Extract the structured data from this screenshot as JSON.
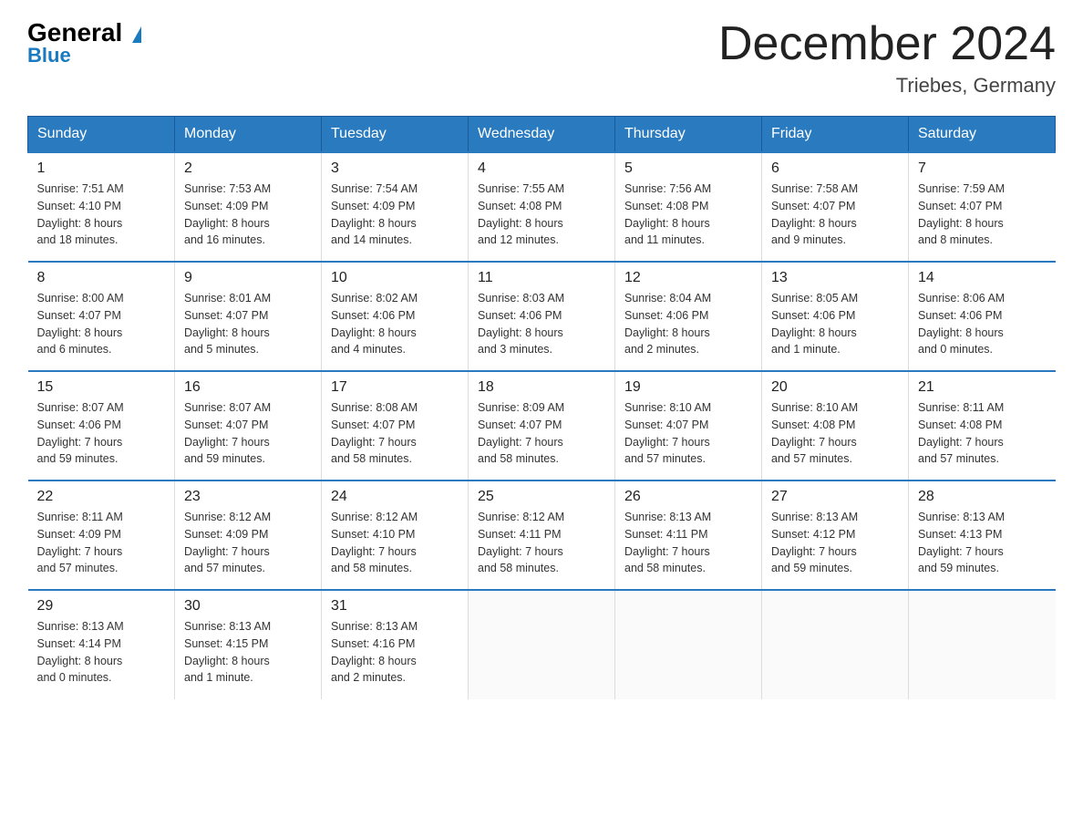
{
  "logo": {
    "general": "General",
    "blue": "Blue",
    "triangle": "▲"
  },
  "title": "December 2024",
  "subtitle": "Triebes, Germany",
  "days_of_week": [
    "Sunday",
    "Monday",
    "Tuesday",
    "Wednesday",
    "Thursday",
    "Friday",
    "Saturday"
  ],
  "weeks": [
    [
      {
        "num": "1",
        "info": "Sunrise: 7:51 AM\nSunset: 4:10 PM\nDaylight: 8 hours\nand 18 minutes."
      },
      {
        "num": "2",
        "info": "Sunrise: 7:53 AM\nSunset: 4:09 PM\nDaylight: 8 hours\nand 16 minutes."
      },
      {
        "num": "3",
        "info": "Sunrise: 7:54 AM\nSunset: 4:09 PM\nDaylight: 8 hours\nand 14 minutes."
      },
      {
        "num": "4",
        "info": "Sunrise: 7:55 AM\nSunset: 4:08 PM\nDaylight: 8 hours\nand 12 minutes."
      },
      {
        "num": "5",
        "info": "Sunrise: 7:56 AM\nSunset: 4:08 PM\nDaylight: 8 hours\nand 11 minutes."
      },
      {
        "num": "6",
        "info": "Sunrise: 7:58 AM\nSunset: 4:07 PM\nDaylight: 8 hours\nand 9 minutes."
      },
      {
        "num": "7",
        "info": "Sunrise: 7:59 AM\nSunset: 4:07 PM\nDaylight: 8 hours\nand 8 minutes."
      }
    ],
    [
      {
        "num": "8",
        "info": "Sunrise: 8:00 AM\nSunset: 4:07 PM\nDaylight: 8 hours\nand 6 minutes."
      },
      {
        "num": "9",
        "info": "Sunrise: 8:01 AM\nSunset: 4:07 PM\nDaylight: 8 hours\nand 5 minutes."
      },
      {
        "num": "10",
        "info": "Sunrise: 8:02 AM\nSunset: 4:06 PM\nDaylight: 8 hours\nand 4 minutes."
      },
      {
        "num": "11",
        "info": "Sunrise: 8:03 AM\nSunset: 4:06 PM\nDaylight: 8 hours\nand 3 minutes."
      },
      {
        "num": "12",
        "info": "Sunrise: 8:04 AM\nSunset: 4:06 PM\nDaylight: 8 hours\nand 2 minutes."
      },
      {
        "num": "13",
        "info": "Sunrise: 8:05 AM\nSunset: 4:06 PM\nDaylight: 8 hours\nand 1 minute."
      },
      {
        "num": "14",
        "info": "Sunrise: 8:06 AM\nSunset: 4:06 PM\nDaylight: 8 hours\nand 0 minutes."
      }
    ],
    [
      {
        "num": "15",
        "info": "Sunrise: 8:07 AM\nSunset: 4:06 PM\nDaylight: 7 hours\nand 59 minutes."
      },
      {
        "num": "16",
        "info": "Sunrise: 8:07 AM\nSunset: 4:07 PM\nDaylight: 7 hours\nand 59 minutes."
      },
      {
        "num": "17",
        "info": "Sunrise: 8:08 AM\nSunset: 4:07 PM\nDaylight: 7 hours\nand 58 minutes."
      },
      {
        "num": "18",
        "info": "Sunrise: 8:09 AM\nSunset: 4:07 PM\nDaylight: 7 hours\nand 58 minutes."
      },
      {
        "num": "19",
        "info": "Sunrise: 8:10 AM\nSunset: 4:07 PM\nDaylight: 7 hours\nand 57 minutes."
      },
      {
        "num": "20",
        "info": "Sunrise: 8:10 AM\nSunset: 4:08 PM\nDaylight: 7 hours\nand 57 minutes."
      },
      {
        "num": "21",
        "info": "Sunrise: 8:11 AM\nSunset: 4:08 PM\nDaylight: 7 hours\nand 57 minutes."
      }
    ],
    [
      {
        "num": "22",
        "info": "Sunrise: 8:11 AM\nSunset: 4:09 PM\nDaylight: 7 hours\nand 57 minutes."
      },
      {
        "num": "23",
        "info": "Sunrise: 8:12 AM\nSunset: 4:09 PM\nDaylight: 7 hours\nand 57 minutes."
      },
      {
        "num": "24",
        "info": "Sunrise: 8:12 AM\nSunset: 4:10 PM\nDaylight: 7 hours\nand 58 minutes."
      },
      {
        "num": "25",
        "info": "Sunrise: 8:12 AM\nSunset: 4:11 PM\nDaylight: 7 hours\nand 58 minutes."
      },
      {
        "num": "26",
        "info": "Sunrise: 8:13 AM\nSunset: 4:11 PM\nDaylight: 7 hours\nand 58 minutes."
      },
      {
        "num": "27",
        "info": "Sunrise: 8:13 AM\nSunset: 4:12 PM\nDaylight: 7 hours\nand 59 minutes."
      },
      {
        "num": "28",
        "info": "Sunrise: 8:13 AM\nSunset: 4:13 PM\nDaylight: 7 hours\nand 59 minutes."
      }
    ],
    [
      {
        "num": "29",
        "info": "Sunrise: 8:13 AM\nSunset: 4:14 PM\nDaylight: 8 hours\nand 0 minutes."
      },
      {
        "num": "30",
        "info": "Sunrise: 8:13 AM\nSunset: 4:15 PM\nDaylight: 8 hours\nand 1 minute."
      },
      {
        "num": "31",
        "info": "Sunrise: 8:13 AM\nSunset: 4:16 PM\nDaylight: 8 hours\nand 2 minutes."
      },
      null,
      null,
      null,
      null
    ]
  ]
}
